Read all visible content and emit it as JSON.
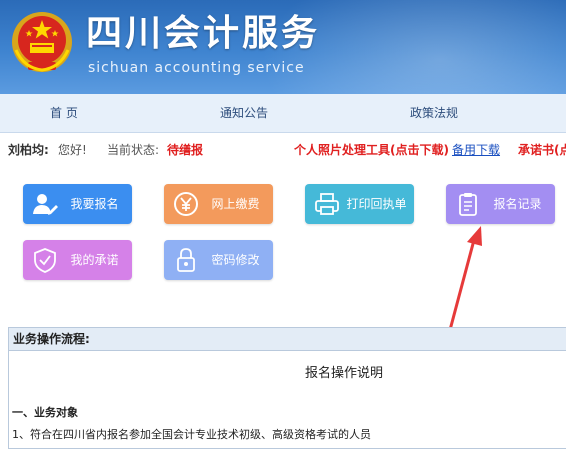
{
  "header": {
    "title": "四川会计服务",
    "subtitle": "sichuan accounting service"
  },
  "nav": {
    "items": [
      "首 页",
      "通知公告",
      "政策法规"
    ]
  },
  "status_bar": {
    "name": "刘柏均:",
    "greeting": "您好!",
    "state_label": "当前状态:",
    "state_value": "待缮报",
    "photo_tool_link": "个人照片处理工具(点击下载)",
    "backup_download_link": "备用下载",
    "promise_link": "承诺书(点"
  },
  "actions": [
    {
      "label": "我要报名",
      "icon": "person-edit-icon",
      "color": "#3b8ef0"
    },
    {
      "label": "网上缴费",
      "icon": "yen-coin-icon",
      "color": "#f39a5c"
    },
    {
      "label": "打印回执单",
      "icon": "printer-icon",
      "color": "#45b9d8"
    },
    {
      "label": "报名记录",
      "icon": "clipboard-icon",
      "color": "#a38ef2"
    },
    {
      "label": "我的承诺",
      "icon": "shield-check-icon",
      "color": "#d581e8"
    },
    {
      "label": "密码修改",
      "icon": "lock-icon",
      "color": "#8fb0f4"
    }
  ],
  "process": {
    "heading": "业务操作流程:",
    "doc_title": "报名操作说明",
    "section_1": "一、业务对象",
    "line_1": "1、符合在四川省内报名参加全国会计专业技术初级、高级资格考试的人员"
  }
}
